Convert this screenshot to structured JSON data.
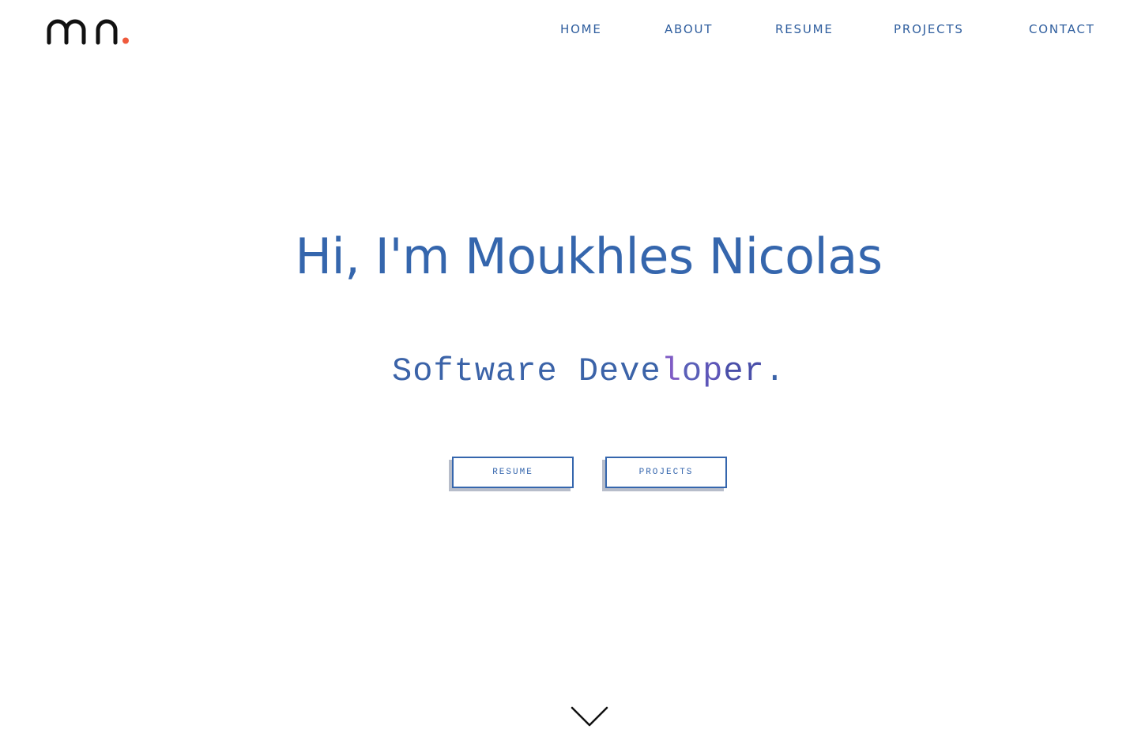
{
  "header": {
    "logo": {
      "text": "mn.",
      "accent_color": "#ef5a3c"
    },
    "nav": {
      "items": [
        {
          "label": "HOME"
        },
        {
          "label": "ABOUT"
        },
        {
          "label": "RESUME"
        },
        {
          "label": "PROJECTS"
        },
        {
          "label": "CONTACT"
        }
      ]
    }
  },
  "hero": {
    "title": "Hi, I'm Moukhles Nicolas",
    "subtitle": {
      "part_1": "Software Deve",
      "part_2": "l",
      "part_3": "o",
      "part_4": "p",
      "part_5": "er",
      "part_6": "."
    },
    "buttons": {
      "resume_label": "RESUME",
      "projects_label": "PROJECTS"
    },
    "scroll_icon": "chevron-down-icon"
  },
  "colors": {
    "primary": "#3566ad",
    "nav_text": "#2f5e9e",
    "logo_dark": "#111111",
    "logo_accent": "#ef5a3c",
    "button_shadow": "#b7bdca"
  }
}
